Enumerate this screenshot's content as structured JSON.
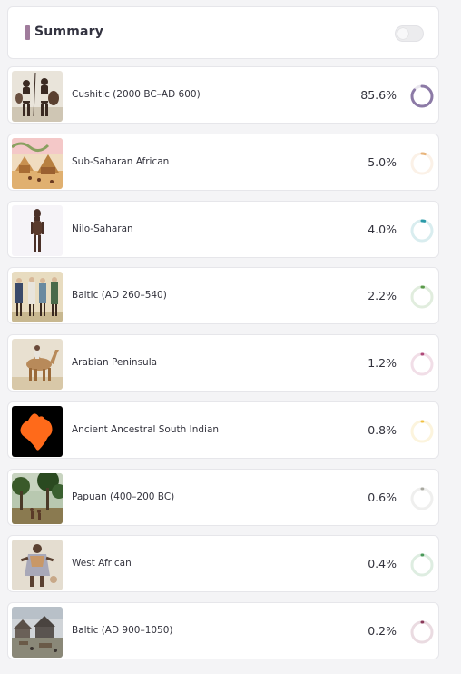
{
  "summary": {
    "title": "Summary",
    "accent_color": "#a07c9c",
    "toggle_state": "off"
  },
  "rows": [
    {
      "label": "Cushitic (2000 BC–AD 600)",
      "percent": "85.6%",
      "value": 85.6,
      "color": "#8c7aa6",
      "icon": "cushitic-warriors-image"
    },
    {
      "label": "Sub-Saharan African",
      "percent": "5.0%",
      "value": 5.0,
      "color": "#e8b47a",
      "icon": "african-village-image"
    },
    {
      "label": "Nilo-Saharan",
      "percent": "4.0%",
      "value": 4.0,
      "color": "#2b9aa8",
      "icon": "wooden-figure-image"
    },
    {
      "label": "Baltic (AD 260–540)",
      "percent": "2.2%",
      "value": 2.2,
      "color": "#5a9a4a",
      "icon": "baltic-warriors-image"
    },
    {
      "label": "Arabian Peninsula",
      "percent": "1.2%",
      "value": 1.2,
      "color": "#b04a7a",
      "icon": "camel-rider-image"
    },
    {
      "label": "Ancient Ancestral South Indian",
      "percent": "0.8%",
      "value": 0.8,
      "color": "#f0c040",
      "icon": "india-map-image"
    },
    {
      "label": "Papuan (400–200 BC)",
      "percent": "0.6%",
      "value": 0.6,
      "color": "#a8a8a0",
      "icon": "jungle-scene-image"
    },
    {
      "label": "West African",
      "percent": "0.4%",
      "value": 0.4,
      "color": "#4a9a5a",
      "icon": "west-african-figure-image"
    },
    {
      "label": "Baltic (AD 900–1050)",
      "percent": "0.2%",
      "value": 0.2,
      "color": "#8a3a5a",
      "icon": "baltic-village-image"
    }
  ]
}
